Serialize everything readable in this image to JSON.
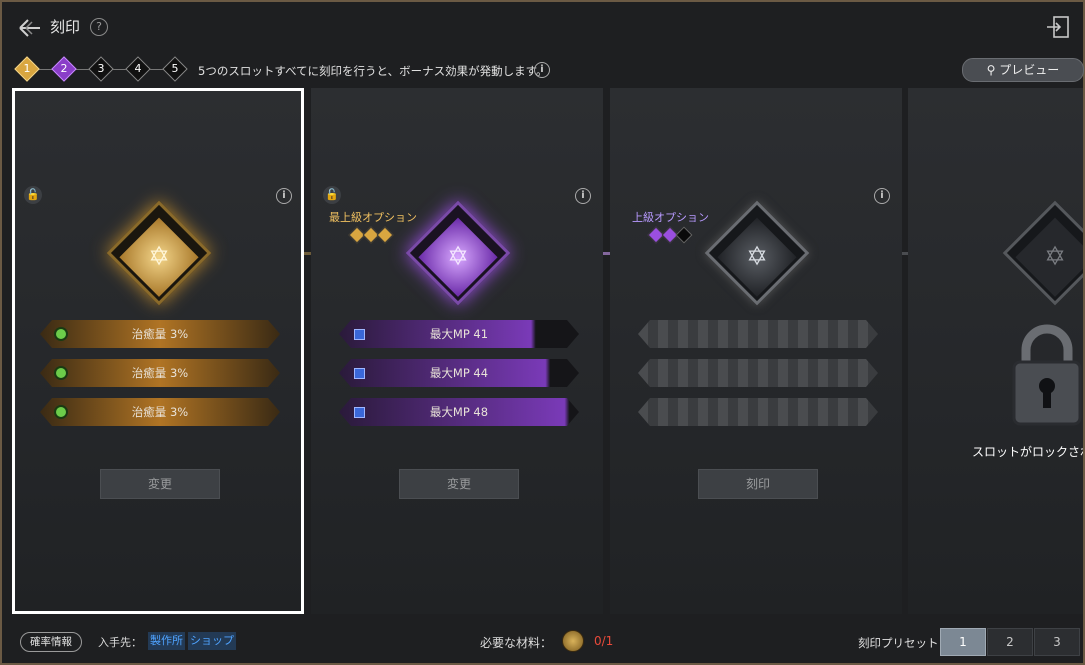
{
  "header": {
    "title": "刻印",
    "help_icon": "question-icon",
    "exit_icon": "exit-icon"
  },
  "steps": [
    {
      "label": "1",
      "state": "gold"
    },
    {
      "label": "2",
      "state": "purple"
    },
    {
      "label": "3",
      "state": "empty"
    },
    {
      "label": "4",
      "state": "empty"
    },
    {
      "label": "5",
      "state": "empty"
    }
  ],
  "step_info": "5つのスロットすべてに刻印を行うと、ボーナス効果が発動します。",
  "preview_label": "プレビュー",
  "slots": [
    {
      "selected": true,
      "grade": "",
      "options": [
        "治癒量 3%",
        "治癒量 3%",
        "治癒量 3%"
      ],
      "button": "変更"
    },
    {
      "selected": false,
      "grade": "最上級オプション",
      "options": [
        "最大MP 41",
        "最大MP 44",
        "最大MP 48"
      ],
      "option_fill": [
        0.82,
        0.88,
        0.96
      ],
      "button": "変更"
    },
    {
      "selected": false,
      "grade": "上級オプション",
      "options": [
        "",
        "",
        ""
      ],
      "button": "刻印"
    },
    {
      "selected": false,
      "locked_text": "スロットがロックされて"
    }
  ],
  "footer": {
    "prob_label": "確率情報",
    "source_label": "入手先：",
    "source_links": [
      "製作所",
      "ショップ"
    ],
    "material_label": "必要な材料：",
    "material_count": "0/1",
    "preset_label": "刻印プリセット",
    "presets": [
      "1",
      "2",
      "3"
    ],
    "active_preset": "1"
  },
  "colors": {
    "gold": "#d9a640",
    "purple": "#9a4fe0",
    "silver": "#b8bcc4",
    "accent_red": "#e84a3a"
  }
}
